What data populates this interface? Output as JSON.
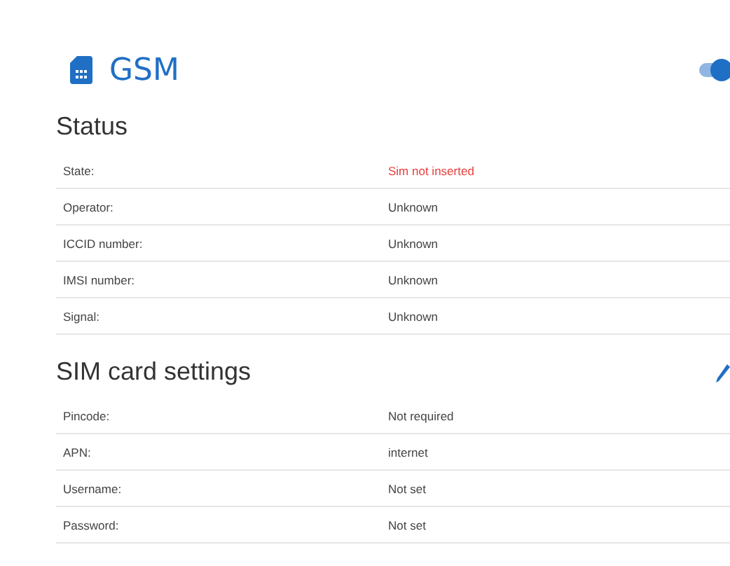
{
  "header": {
    "title": "GSM",
    "toggle": {
      "on": true
    }
  },
  "status": {
    "heading": "Status",
    "rows": [
      {
        "label": "State:",
        "value": "Sim not inserted",
        "alert": true
      },
      {
        "label": "Operator:",
        "value": "Unknown",
        "alert": false
      },
      {
        "label": "ICCID number:",
        "value": "Unknown",
        "alert": false
      },
      {
        "label": "IMSI number:",
        "value": "Unknown",
        "alert": false
      },
      {
        "label": "Signal:",
        "value": "Unknown",
        "alert": false
      }
    ]
  },
  "sim_settings": {
    "heading": "SIM card settings",
    "rows": [
      {
        "label": "Pincode:",
        "value": "Not required",
        "alert": false
      },
      {
        "label": "APN:",
        "value": "internet",
        "alert": false
      },
      {
        "label": "Username:",
        "value": "Not set",
        "alert": false
      },
      {
        "label": "Password:",
        "value": "Not set",
        "alert": false
      }
    ]
  }
}
